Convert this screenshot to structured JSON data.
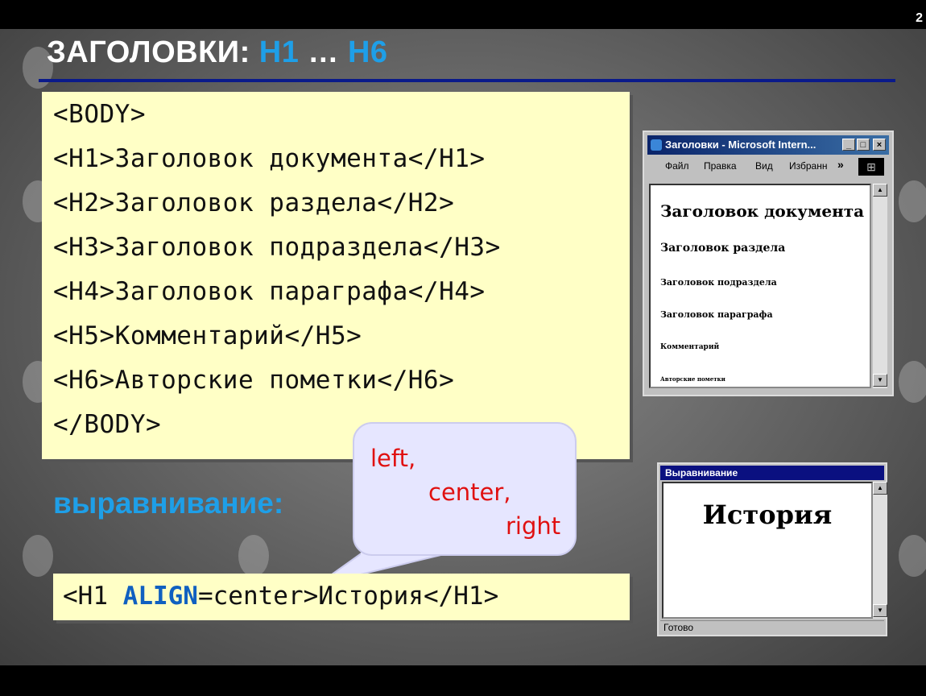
{
  "slide": {
    "number": "2",
    "title_prefix": "ЗАГОЛОВКИ: ",
    "title_h1": "H1",
    "title_dots": " … ",
    "title_h6": "H6"
  },
  "code_block": {
    "lines": [
      "<BODY>",
      "<H1>Заголовок документа</H1>",
      "<H2>Заголовок раздела</H2>",
      "<H3>Заголовок подраздела</H3>",
      "<H4>Заголовок параграфа</H4>",
      "<H5>Комментарий</H5>",
      "<H6>Авторские пометки</H6>",
      "</BODY>"
    ]
  },
  "alignment": {
    "label": "выравнивание:",
    "options": [
      "left,",
      "center,",
      "right"
    ]
  },
  "code_example": {
    "part1": "<H1 ",
    "keyword": "ALIGN",
    "part2": "=center>История</H1>"
  },
  "browser1": {
    "title": "Заголовки - Microsoft Intern...",
    "menu": [
      "Файл",
      "Правка",
      "Вид",
      "Избранн"
    ],
    "more_glyph": "»",
    "headings": [
      "Заголовок документа",
      "Заголовок раздела",
      "Заголовок подраздела",
      "Заголовок параграфа",
      "Комментарий",
      "Авторские пометки"
    ]
  },
  "browser2": {
    "title": "Выравнивание",
    "heading": "История",
    "status": "Готово"
  },
  "colors": {
    "accent_blue": "#1e9fe8",
    "code_bg": "#ffffc6",
    "bubble_bg": "#e6e6ff",
    "bubble_text": "#e01010",
    "rule": "#0a1a8a"
  }
}
